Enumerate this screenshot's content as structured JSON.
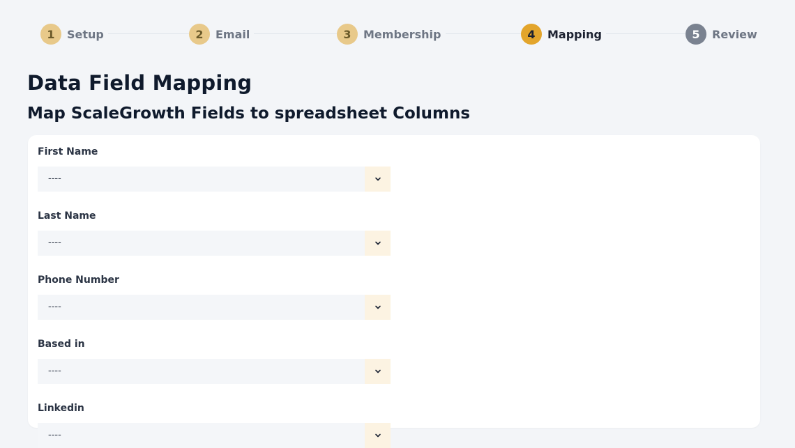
{
  "steps": [
    {
      "number": "1",
      "label": "Setup"
    },
    {
      "number": "2",
      "label": "Email"
    },
    {
      "number": "3",
      "label": "Membership"
    },
    {
      "number": "4",
      "label": "Mapping"
    },
    {
      "number": "5",
      "label": "Review"
    }
  ],
  "current_step": "4",
  "colors": {
    "completed_step": "#e8c98a",
    "current_step": "#e3a52c",
    "future_step": "#7a8290",
    "dropdown_button_bg": "#fcf3e2"
  },
  "page": {
    "title": "Data Field Mapping",
    "subtitle": "Map ScaleGrowth Fields to spreadsheet Columns"
  },
  "fields": [
    {
      "label": "First Name",
      "value": "----"
    },
    {
      "label": "Last Name",
      "value": "----"
    },
    {
      "label": "Phone Number",
      "value": "----"
    },
    {
      "label": "Based in",
      "value": "----"
    },
    {
      "label": "Linkedin",
      "value": "----"
    }
  ],
  "icons": {
    "dropdown": "chevron-down-icon"
  }
}
